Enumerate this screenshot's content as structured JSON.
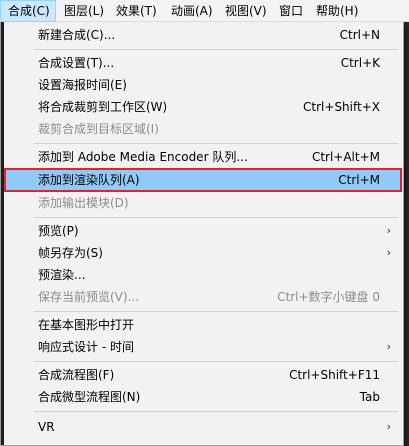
{
  "menubar": {
    "items": [
      {
        "label": "合成(C)"
      },
      {
        "label": "图层(L)"
      },
      {
        "label": "效果(T)"
      },
      {
        "label": "动画(A)"
      },
      {
        "label": "视图(V)"
      },
      {
        "label": "窗口"
      },
      {
        "label": "帮助(H)"
      }
    ]
  },
  "menu": {
    "items": [
      {
        "label": "新建合成(C)...",
        "shortcut": "Ctrl+N"
      },
      {
        "label": "合成设置(T)...",
        "shortcut": "Ctrl+K"
      },
      {
        "label": "设置海报时间(E)",
        "shortcut": ""
      },
      {
        "label": "将合成裁剪到工作区(W)",
        "shortcut": "Ctrl+Shift+X"
      },
      {
        "label": "裁剪合成到目标区域(I)",
        "shortcut": ""
      },
      {
        "label": "添加到 Adobe Media Encoder 队列...",
        "shortcut": "Ctrl+Alt+M"
      },
      {
        "label": "添加到渲染队列(A)",
        "shortcut": "Ctrl+M"
      },
      {
        "label": "添加输出模块(D)",
        "shortcut": ""
      },
      {
        "label": "预览(P)",
        "shortcut": "",
        "arrow": "›"
      },
      {
        "label": "帧另存为(S)",
        "shortcut": "",
        "arrow": "›"
      },
      {
        "label": "预渲染...",
        "shortcut": ""
      },
      {
        "label": "保存当前预览(V)...",
        "shortcut": "Ctrl+数字小键盘 0"
      },
      {
        "label": "在基本图形中打开",
        "shortcut": ""
      },
      {
        "label": "响应式设计 - 时间",
        "shortcut": "",
        "arrow": "›"
      },
      {
        "label": "合成流程图(F)",
        "shortcut": "Ctrl+Shift+F11"
      },
      {
        "label": "合成微型流程图(N)",
        "shortcut": "Tab"
      },
      {
        "label": "VR",
        "shortcut": "",
        "arrow": "›"
      }
    ]
  }
}
